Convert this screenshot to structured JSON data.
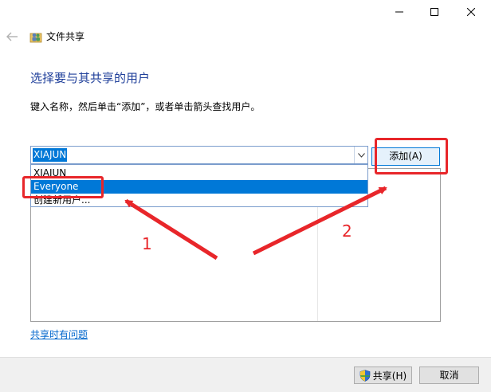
{
  "window": {
    "title": "文件共享",
    "controls": [
      "minimize-icon",
      "maximize-icon",
      "close-icon"
    ]
  },
  "main": {
    "heading": "选择要与其共享的用户",
    "instruction": "键入名称，然后单击“添加”，或者单击箭头查找用户。",
    "combo_value": "XIAJUN",
    "dropdown_items": [
      "XIAJUN",
      "Everyone",
      "创建新用户..."
    ],
    "add_button": "添加(A)",
    "help_link": "共享时有问题"
  },
  "footer": {
    "share_button": "共享(H)",
    "cancel_button": "取消"
  },
  "annotations": {
    "label_1": "1",
    "label_2": "2",
    "color": "#e8262a"
  },
  "colors": {
    "heading": "#1f3f9a",
    "selection": "#0078d7",
    "link": "#0066cc"
  }
}
